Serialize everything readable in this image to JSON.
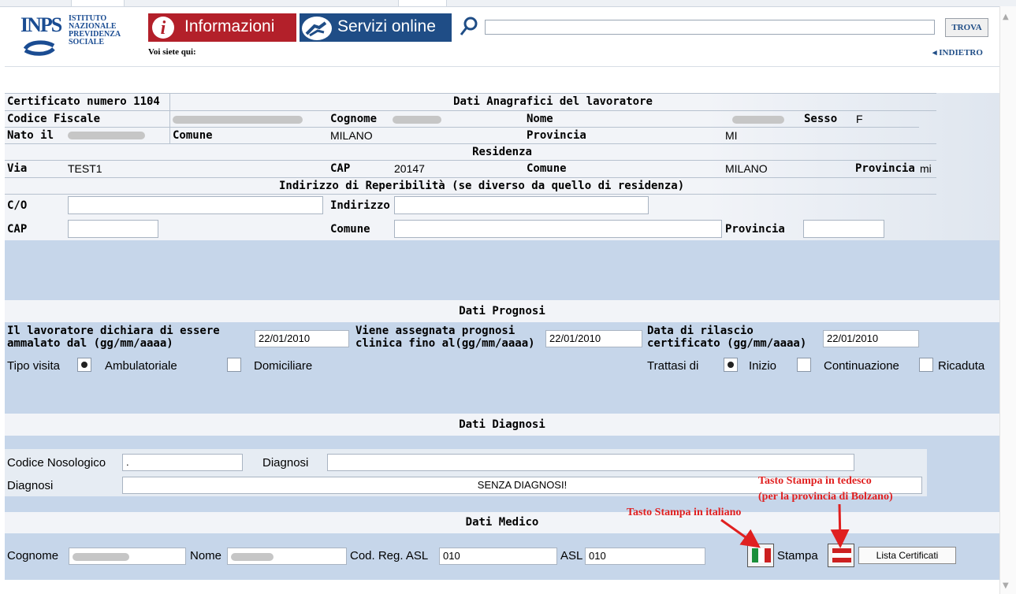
{
  "header": {
    "logo_text": "INPS",
    "org_name": [
      "ISTITUTO",
      "NAZIONALE",
      "PREVIDENZA",
      "SOCIALE"
    ],
    "tab_info": "Informazioni",
    "tab_services": "Servizi online",
    "search_value": "",
    "search_button": "TROVA",
    "breadcrumb_label": "Voi siete qui:",
    "back_link": "INDIETRO"
  },
  "anagrafica": {
    "cert_number": "Certificato numero 1104",
    "section_title": "Dati Anagrafici del lavoratore",
    "codice_fiscale_label": "Codice Fiscale",
    "cognome_label": "Cognome",
    "nome_label": "Nome",
    "sesso_label": "Sesso",
    "sesso_value": "F",
    "nato_label": "Nato il",
    "comune_label": "Comune",
    "comune_value": "MILANO",
    "provincia_label": "Provincia",
    "provincia_value": "MI"
  },
  "residenza": {
    "title": "Residenza",
    "via_label": "Via",
    "via_value": "TEST1",
    "cap_label": "CAP",
    "cap_value": "20147",
    "comune_label": "Comune",
    "comune_value": "MILANO",
    "provincia_label": "Provincia",
    "provincia_value": "mi"
  },
  "reperibilita": {
    "title": "Indirizzo di Reperibilità (se diverso da quello di residenza)",
    "co_label": "C/O",
    "indirizzo_label": "Indirizzo",
    "cap_label": "CAP",
    "comune_label": "Comune",
    "provincia_label": "Provincia"
  },
  "prognosi": {
    "title": "Dati Prognosi",
    "dichiara_label": "Il lavoratore dichiara di essere ammalato dal (gg/mm/aaaa)",
    "dichiara_value": "22/01/2010",
    "assegnata_label": "Viene assegnata prognosi clinica fino al(gg/mm/aaaa)",
    "assegnata_value": "22/01/2010",
    "rilascio_label": "Data di rilascio certificato (gg/mm/aaaa)",
    "rilascio_value": "22/01/2010",
    "tipo_visita_label": "Tipo visita",
    "ambulatoriale": "Ambulatoriale",
    "domiciliare": "Domiciliare",
    "trattasi_label": "Trattasi di",
    "inizio": "Inizio",
    "continuazione": "Continuazione",
    "ricaduta": "Ricaduta"
  },
  "diagnosi": {
    "title": "Dati Diagnosi",
    "codice_label": "Codice Nosologico",
    "codice_value": ".",
    "diagnosi_label": "Diagnosi",
    "diagnosi2_label": "Diagnosi",
    "senza": "SENZA DIAGNOSI!"
  },
  "medico": {
    "title": "Dati Medico",
    "cognome_label": "Cognome",
    "nome_label": "Nome",
    "codreg_label": "Cod. Reg. ASL",
    "codreg_value": "010",
    "asl_label": "ASL",
    "asl_value": "010",
    "stampa_label": "Stampa",
    "lista_button": "Lista Certificati"
  },
  "annotations": {
    "tedesco_line1": "Tasto Stampa in tedesco",
    "tedesco_line2": "(per la provincia di Bolzano)",
    "italiano": "Tasto Stampa in italiano"
  },
  "colors": {
    "band_blue": "#c6d6ea",
    "band_light": "#f2f4f8",
    "tab_red": "#b3202a",
    "tab_blue": "#1f4d86",
    "annotation_red": "#e02020"
  }
}
